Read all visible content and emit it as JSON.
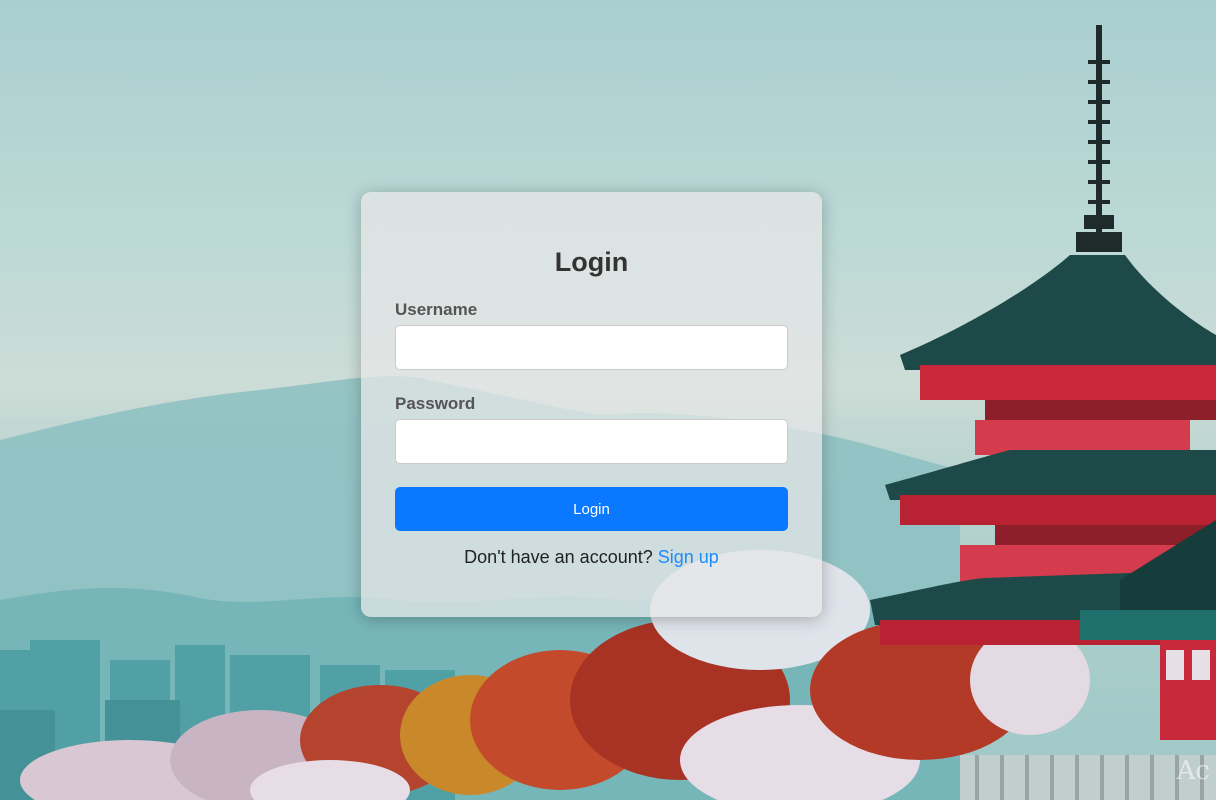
{
  "login": {
    "title": "Login",
    "username_label": "Username",
    "username_value": "",
    "password_label": "Password",
    "password_value": "",
    "submit_label": "Login",
    "signup_prompt": "Don't have an account?",
    "signup_link": "Sign up"
  },
  "colors": {
    "primary": "#0a78ff",
    "link": "#1a8cff"
  },
  "watermark": "Ac"
}
